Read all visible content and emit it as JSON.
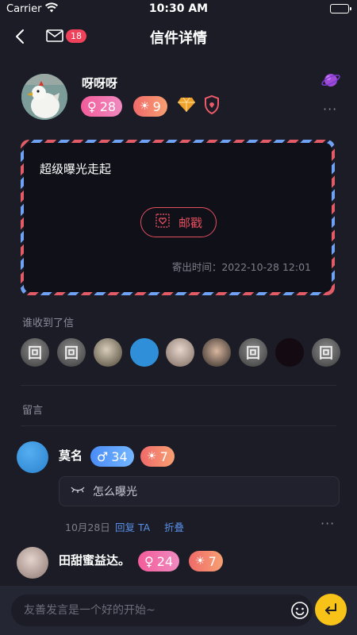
{
  "status_bar": {
    "carrier": "Carrier",
    "time": "10:30 AM"
  },
  "nav": {
    "title": "信件详情",
    "mail_badge": "18"
  },
  "sender": {
    "name": "呀呀呀",
    "gender_tag": {
      "symbol": "♀",
      "value": "28"
    },
    "level_tag": {
      "value": "9"
    }
  },
  "letter": {
    "content": "超级曝光走起",
    "stamp_label": "邮戳",
    "sent_time": "寄出时间：2022-10-28 12:01"
  },
  "receivers_label": "谁收到了信",
  "comments_label": "留言",
  "comments": [
    {
      "name": "莫名",
      "gender_tag": {
        "symbol": "♂",
        "value": "34"
      },
      "level_tag": {
        "value": "7"
      },
      "text": "怎么曝光",
      "date": "10月28日",
      "reply": "回复 TA",
      "fold": "折叠"
    },
    {
      "name": "田甜蜜益达。",
      "gender_tag": {
        "symbol": "♀",
        "value": "24"
      },
      "level_tag": {
        "value": "7"
      }
    }
  ],
  "input": {
    "placeholder": "友善发言是一个好的开始~"
  },
  "colors": {
    "accent_red": "#e44f5e",
    "send_yellow": "#f7c318",
    "link_blue": "#5a8fe6"
  }
}
